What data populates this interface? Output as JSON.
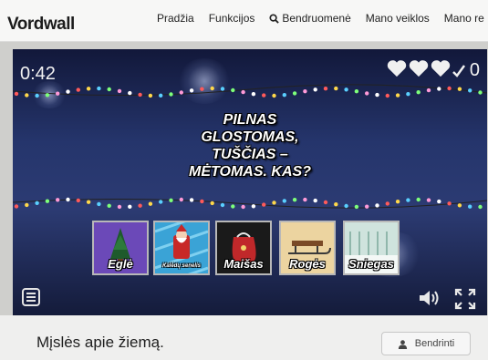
{
  "header": {
    "logo": "Vordwall",
    "nav": [
      {
        "label": "Pradžia"
      },
      {
        "label": "Funkcijos"
      },
      {
        "label": "Bendruomenė",
        "icon": "search-icon"
      },
      {
        "label": "Mano veiklos"
      },
      {
        "label": "Mano re"
      }
    ]
  },
  "game": {
    "timer": "0:42",
    "lives": 3,
    "lives_icon": "heart-icon",
    "score": "0",
    "score_icon": "check-icon",
    "question_lines": [
      "PILNAS",
      "GLOSTOMAS,",
      "TUŠČIAS –",
      "MĖTOMAS. KAS?"
    ],
    "answers": [
      {
        "label": "Eglė",
        "icon": "christmas-tree-icon",
        "color": "#6b49b8"
      },
      {
        "label": "Kalėdų senelis",
        "icon": "santa-icon",
        "color": "#3aa3d6"
      },
      {
        "label": "Maišas",
        "icon": "gift-bag-icon",
        "color": "#1a1a1a"
      },
      {
        "label": "Rogės",
        "icon": "sled-icon",
        "color": "#e9c787"
      },
      {
        "label": "Sniegas",
        "icon": "snow-icon",
        "color": "#5aa890"
      }
    ]
  },
  "footer": {
    "title": "Mįslės apie žiemą.",
    "share_label": "Bendrinti",
    "share_icon": "user-icon"
  }
}
